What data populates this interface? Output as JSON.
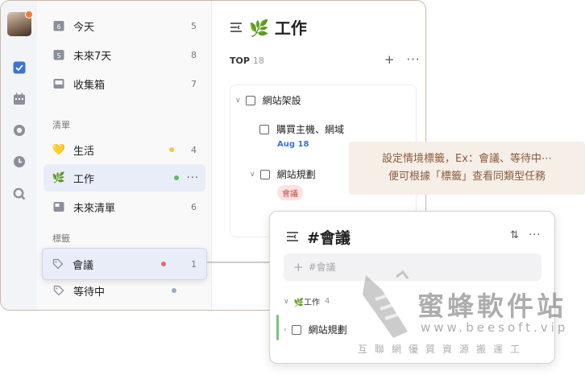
{
  "sidebar": {
    "smart_lists": [
      {
        "label": "今天",
        "count": "5",
        "icon": "calendar-6-icon",
        "icon_text": "6"
      },
      {
        "label": "未來7天",
        "count": "8",
        "icon": "calendar-s-icon",
        "icon_text": "S"
      },
      {
        "label": "收集箱",
        "count": "7",
        "icon": "inbox-icon"
      }
    ],
    "lists_title": "清單",
    "lists": [
      {
        "label": "生活",
        "count": "4",
        "emoji": "💛",
        "dot_color": "#f5c842"
      },
      {
        "label": "工作",
        "emoji": "🌿",
        "dot_color": "#5fb86a",
        "more": "···"
      },
      {
        "label": "未來清單",
        "count": "6"
      }
    ],
    "tags_title": "標籤",
    "tags": [
      {
        "label": "會議",
        "count": "1",
        "dot_color": "#e86a6a"
      },
      {
        "label": "等待中",
        "dot_color": "#9aaac4"
      }
    ]
  },
  "main": {
    "title": "🌿 工作",
    "section": {
      "name": "TOP",
      "count": "18",
      "add": "+",
      "more": "···"
    },
    "tasks": [
      {
        "title": "網站架設"
      },
      {
        "title": "購買主機、網域",
        "date": "Aug 18"
      },
      {
        "title": "網站規劃",
        "tag": "會議"
      }
    ]
  },
  "callout": {
    "line1": "設定情境標籤，Ex：會議、等待中⋯",
    "line2": "便可根據「標籤」查看同類型任務"
  },
  "panel": {
    "title": "#會議",
    "sort": "⇅",
    "more": "···",
    "input_placeholder": "#會議",
    "group": {
      "label": "🌿工作",
      "count": "4"
    },
    "task": "網站規劃"
  },
  "watermark": {
    "title": "蜜蜂軟件站",
    "url": "www.beesoft.vip",
    "subtitle": "互聯網優質資源搬運工"
  },
  "colors": {
    "accent": "#3b73d6",
    "callout_text": "#8b5a3c",
    "tag_red": "#c4504a",
    "active_bg": "#e9edf8"
  }
}
